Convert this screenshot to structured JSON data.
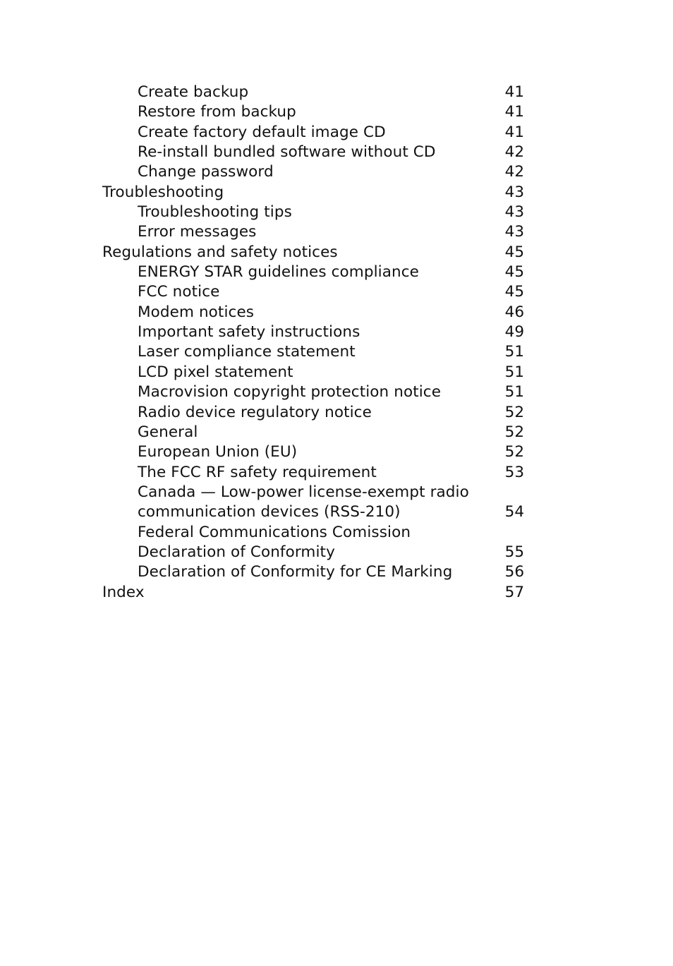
{
  "toc": {
    "entries": [
      {
        "level": 2,
        "lines": [
          "Create backup"
        ],
        "page": "41"
      },
      {
        "level": 2,
        "lines": [
          "Restore from backup"
        ],
        "page": "41"
      },
      {
        "level": 2,
        "lines": [
          "Create factory default image CD"
        ],
        "page": "41"
      },
      {
        "level": 2,
        "lines": [
          "Re-install bundled software without CD"
        ],
        "page": "42"
      },
      {
        "level": 2,
        "lines": [
          "Change password"
        ],
        "page": "42"
      },
      {
        "level": 1,
        "lines": [
          "Troubleshooting"
        ],
        "page": "43"
      },
      {
        "level": 2,
        "lines": [
          "Troubleshooting tips"
        ],
        "page": "43"
      },
      {
        "level": 2,
        "lines": [
          "Error messages"
        ],
        "page": "43"
      },
      {
        "level": 1,
        "lines": [
          "Regulations and safety notices"
        ],
        "page": "45"
      },
      {
        "level": 2,
        "lines": [
          "ENERGY STAR guidelines compliance"
        ],
        "page": "45"
      },
      {
        "level": 2,
        "lines": [
          "FCC notice"
        ],
        "page": "45"
      },
      {
        "level": 2,
        "lines": [
          "Modem notices"
        ],
        "page": "46"
      },
      {
        "level": 2,
        "lines": [
          "Important safety instructions"
        ],
        "page": "49"
      },
      {
        "level": 2,
        "lines": [
          "Laser compliance statement"
        ],
        "page": "51"
      },
      {
        "level": 2,
        "lines": [
          "LCD pixel statement"
        ],
        "page": "51"
      },
      {
        "level": 2,
        "lines": [
          "Macrovision copyright protection notice"
        ],
        "page": "51"
      },
      {
        "level": 2,
        "lines": [
          "Radio device regulatory notice"
        ],
        "page": "52"
      },
      {
        "level": 2,
        "lines": [
          "General"
        ],
        "page": "52"
      },
      {
        "level": 2,
        "lines": [
          "European Union (EU)"
        ],
        "page": "52"
      },
      {
        "level": 2,
        "lines": [
          "The FCC RF safety requirement"
        ],
        "page": "53"
      },
      {
        "level": 2,
        "lines": [
          "Canada — Low-power license-exempt radio",
          "communication devices (RSS-210)"
        ],
        "page": "54"
      },
      {
        "level": 2,
        "lines": [
          "Federal Communications Comission",
          "Declaration of Conformity"
        ],
        "page": "55"
      },
      {
        "level": 2,
        "lines": [
          "Declaration of Conformity for CE Marking"
        ],
        "page": "56"
      },
      {
        "level": 1,
        "lines": [
          "Index"
        ],
        "page": "57"
      }
    ]
  }
}
